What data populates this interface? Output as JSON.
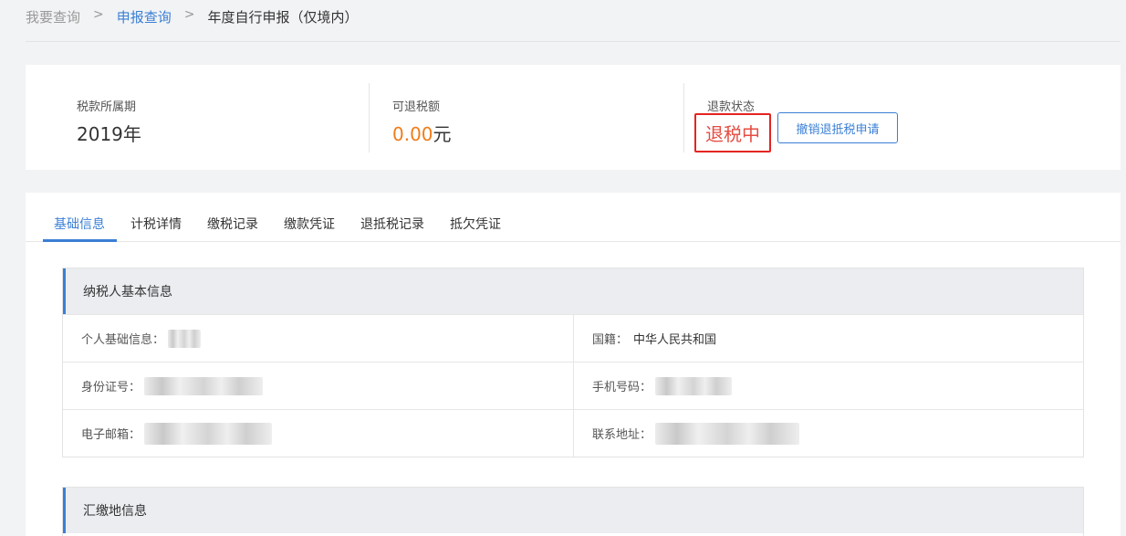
{
  "breadcrumb": {
    "items": [
      {
        "label": "我要查询"
      },
      {
        "label": "申报查询"
      },
      {
        "label": "年度自行申报（仅境内）"
      }
    ],
    "separator": ">"
  },
  "summary": {
    "period": {
      "label": "税款所属期",
      "value": "2019年"
    },
    "refund": {
      "label": "可退税额",
      "amount": "0.00",
      "unit": "元"
    },
    "status": {
      "label": "退款状态",
      "value": "退税中",
      "cancel_button": "撤销退抵税申请"
    }
  },
  "tabs": [
    {
      "label": "基础信息",
      "active": true
    },
    {
      "label": "计税详情",
      "active": false
    },
    {
      "label": "缴税记录",
      "active": false
    },
    {
      "label": "缴款凭证",
      "active": false
    },
    {
      "label": "退抵税记录",
      "active": false
    },
    {
      "label": "抵欠凭证",
      "active": false
    }
  ],
  "taxpayer_section": {
    "title": "纳税人基本信息",
    "fields": {
      "personal_info": {
        "label": "个人基础信息："
      },
      "nationality": {
        "label": "国籍：",
        "value": "中华人民共和国"
      },
      "id_number": {
        "label": "身份证号："
      },
      "phone": {
        "label": "手机号码："
      },
      "email": {
        "label": "电子邮箱："
      },
      "address": {
        "label": "联系地址："
      }
    }
  },
  "payment_section": {
    "title": "汇缴地信息"
  },
  "colors": {
    "accent": "#3a7fd5",
    "amount": "#f07d1a",
    "status_text": "#e54d42",
    "status_border": "#e52420"
  }
}
